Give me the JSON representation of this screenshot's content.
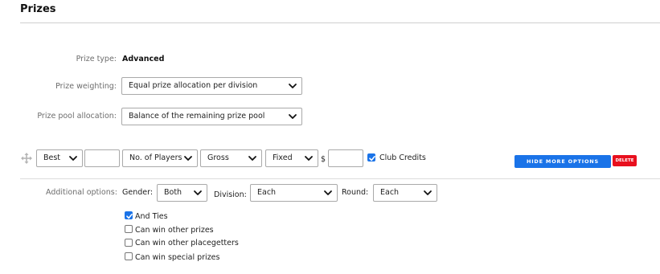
{
  "page": {
    "title": "Prizes"
  },
  "prize_type": {
    "label": "Prize type:",
    "value": "Advanced"
  },
  "prize_weighting": {
    "label": "Prize weighting:",
    "selected": "Equal prize allocation per division"
  },
  "prize_pool": {
    "label": "Prize pool allocation:",
    "selected": "Balance of the remaining prize pool"
  },
  "prize_row": {
    "drag_icon": "move-icon",
    "best": "Best",
    "criteria": "No. of Players",
    "score_type": "Gross",
    "amount_type": "Fixed",
    "currency": "$",
    "club_credits": {
      "label": "Club Credits",
      "checked": true
    },
    "hide_more_label": "HIDE MORE OPTIONS",
    "delete_label": "DELETE"
  },
  "additional": {
    "label": "Additional options:",
    "gender_label": "Gender:",
    "gender": "Both",
    "division_label": "Division:",
    "division": "Each",
    "round_label": "Round:",
    "round": "Each",
    "checkboxes": [
      {
        "label": "And Ties",
        "checked": true
      },
      {
        "label": "Can win other prizes",
        "checked": false
      },
      {
        "label": "Can win other placegetters",
        "checked": false
      },
      {
        "label": "Can win special prizes",
        "checked": false
      }
    ]
  },
  "colors": {
    "primary": "#1a73e8",
    "danger": "#e8101e"
  }
}
